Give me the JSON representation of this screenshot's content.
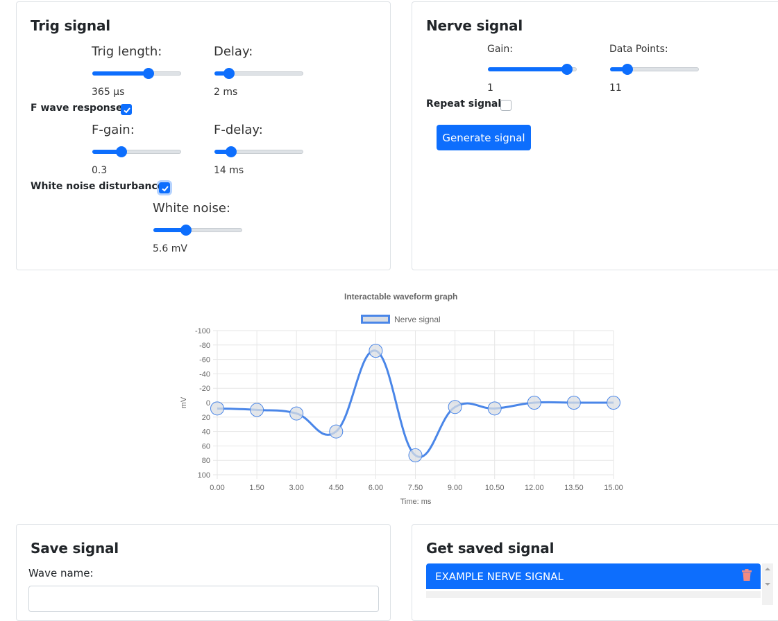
{
  "trig": {
    "title": "Trig signal",
    "trig_length": {
      "label": "Trig length:",
      "value": "365 µs",
      "fraction": 0.65
    },
    "delay": {
      "label": "Delay:",
      "value": "2 ms",
      "fraction": 0.12
    },
    "f_wave": {
      "label": "F wave response",
      "checked": true
    },
    "f_gain": {
      "label": "F-gain:",
      "value": "0.3",
      "fraction": 0.3
    },
    "f_delay": {
      "label": "F-delay:",
      "value": "14 ms",
      "fraction": 0.14
    },
    "white_noise_dist": {
      "label": "White noise disturbance",
      "checked": true
    },
    "white_noise": {
      "label": "White noise:",
      "value": "5.6 mV",
      "fraction": 0.35
    }
  },
  "nerve": {
    "title": "Nerve signal",
    "gain": {
      "label": "Gain:",
      "value": "1",
      "fraction": 0.95
    },
    "data_points": {
      "label": "Data Points:",
      "value": "11",
      "fraction": 0.15
    },
    "repeat": {
      "label": "Repeat signal",
      "checked": false
    },
    "generate_label": "Generate signal"
  },
  "colors": {
    "accent": "#0d6efd",
    "series_line": "#4a86e8",
    "point_fill": "#d9dde3",
    "delete_icon": "#f28b82"
  },
  "chart_data": {
    "type": "line",
    "title": "Interactable waveform graph",
    "legend": "Nerve signal",
    "legend_position": "top",
    "xlabel": "Time: ms",
    "ylabel": "mV",
    "y_reversed": true,
    "grid": true,
    "x_ticks": [
      "0.00",
      "1.50",
      "3.00",
      "4.50",
      "6.00",
      "7.50",
      "9.00",
      "10.50",
      "12.00",
      "13.50",
      "15.00"
    ],
    "y_ticks": [
      "-100",
      "-80",
      "-60",
      "-40",
      "-20",
      "0",
      "20",
      "40",
      "60",
      "80",
      "100"
    ],
    "xlim": [
      0,
      15
    ],
    "ylim": [
      -100,
      100
    ],
    "series": [
      {
        "name": "Nerve signal",
        "x": [
          0,
          1.5,
          3,
          4.5,
          6,
          7.5,
          9,
          10.5,
          12,
          13.5,
          15
        ],
        "y": [
          8,
          10,
          15,
          40,
          -72,
          73,
          6,
          8,
          0,
          0,
          0
        ]
      }
    ]
  },
  "save": {
    "title": "Save signal",
    "wave_name_label": "Wave name:"
  },
  "saved": {
    "title": "Get saved signal",
    "items": [
      {
        "label": "EXAMPLE NERVE SIGNAL"
      }
    ],
    "delete_icon": "trash-icon"
  }
}
